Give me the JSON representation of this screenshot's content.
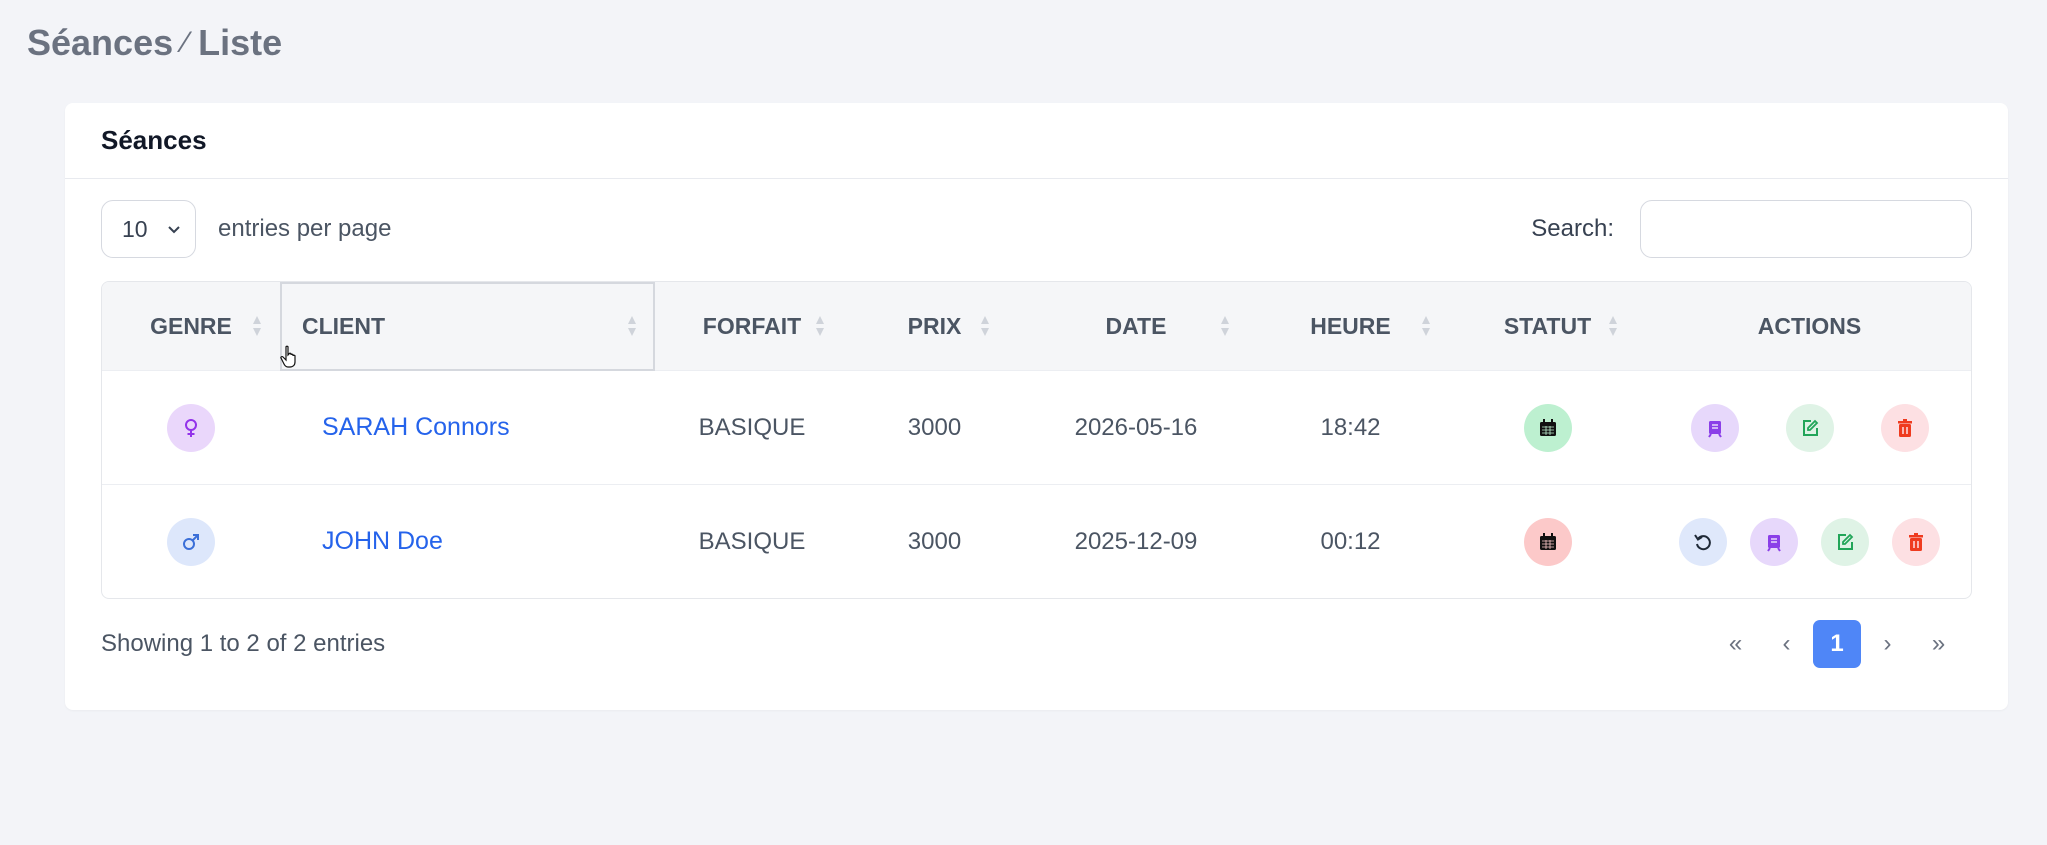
{
  "breadcrumb": {
    "section": "Séances",
    "separator": "⁄",
    "page": "Liste"
  },
  "card": {
    "title": "Séances"
  },
  "controls": {
    "per_page_value": "10",
    "per_page_label": "entries per page",
    "search_label": "Search:",
    "search_value": ""
  },
  "table": {
    "headers": {
      "genre": "GENRE",
      "client": "CLIENT",
      "forfait": "FORFAIT",
      "prix": "PRIX",
      "date": "DATE",
      "heure": "HEURE",
      "statut": "STATUT",
      "actions": "ACTIONS"
    },
    "rows": [
      {
        "genre_icon": "female-icon",
        "client": "SARAH Connors",
        "forfait": "BASIQUE",
        "prix": "3000",
        "date": "2026-05-16",
        "heure": "18:42",
        "statut_icon": "calendar-icon",
        "statut_color": "#bdf0d0",
        "actions": [
          "receipt-icon",
          "edit-icon",
          "trash-icon"
        ]
      },
      {
        "genre_icon": "male-icon",
        "client": "JOHN Doe",
        "forfait": "BASIQUE",
        "prix": "3000",
        "date": "2025-12-09",
        "heure": "00:12",
        "statut_icon": "calendar-icon",
        "statut_color": "#fcc9c9",
        "actions": [
          "restore-icon",
          "receipt-icon",
          "edit-icon",
          "trash-icon"
        ]
      }
    ]
  },
  "footer": {
    "info": "Showing 1 to 2 of 2 entries",
    "pagination": {
      "first": "«",
      "prev": "‹",
      "current": "1",
      "next": "›",
      "last": "»"
    }
  },
  "colors": {
    "accent": "#4f86f7",
    "link": "#2563eb",
    "female_bg": "#ead7fb",
    "male_bg": "#dde7fb",
    "receipt_bg": "#e7d8fb",
    "edit_bg": "#dff3e6",
    "trash_bg": "#fde0e3",
    "restore_bg": "#dfe8fb"
  }
}
